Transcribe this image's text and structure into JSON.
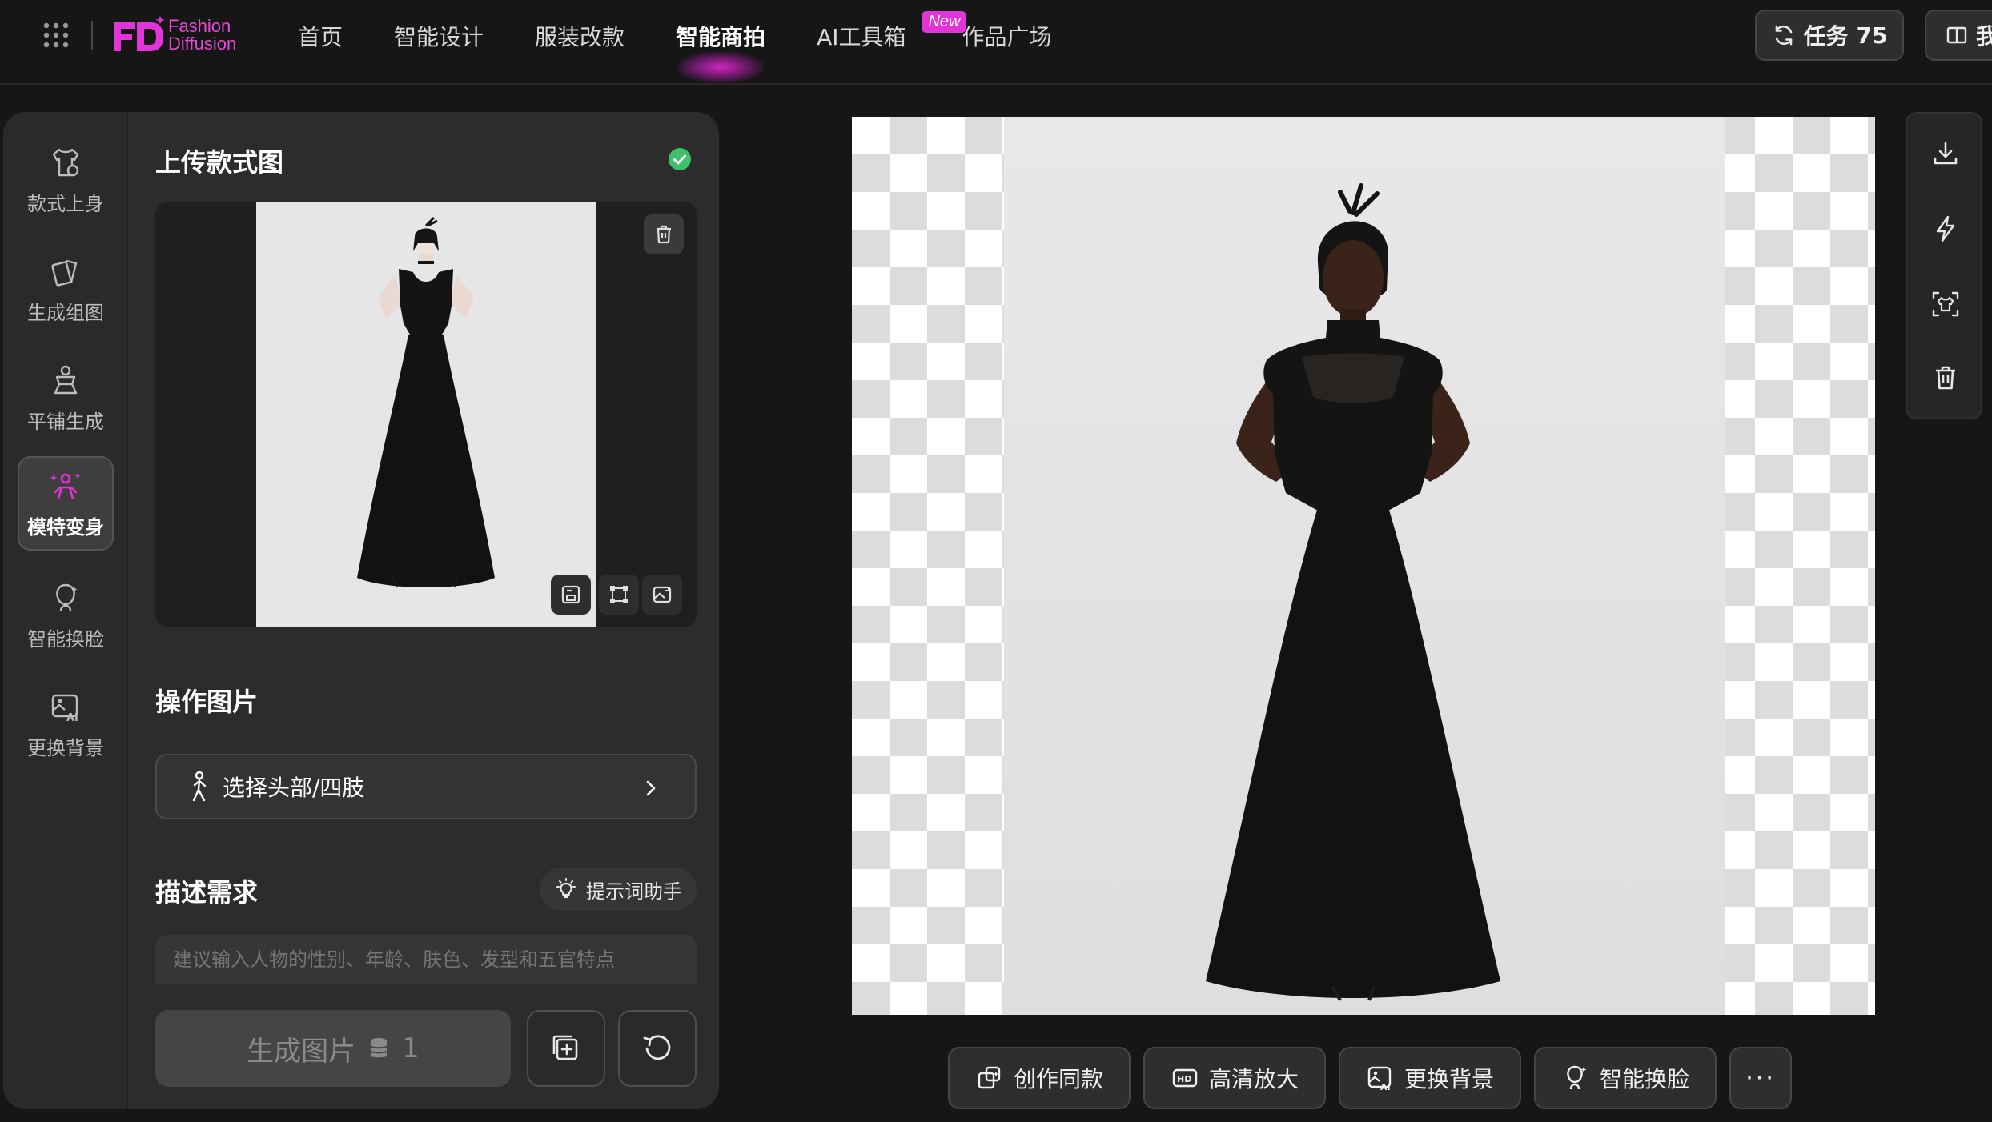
{
  "app": {
    "logo_line1": "Fashion",
    "logo_line2": "Diffusion",
    "brand_color": "#e234d8"
  },
  "nav": {
    "items": [
      {
        "label": "首页"
      },
      {
        "label": "智能设计"
      },
      {
        "label": "服装改款"
      },
      {
        "label": "智能商拍",
        "active": true
      },
      {
        "label": "AI工具箱",
        "badge": "New"
      },
      {
        "label": "作品广场"
      }
    ]
  },
  "header": {
    "tasks_label": "任务",
    "tasks_count": "75",
    "book_label": "我"
  },
  "tools": [
    {
      "label": "款式上身",
      "icon": "shirt-icon"
    },
    {
      "label": "生成组图",
      "icon": "cards-icon"
    },
    {
      "label": "平铺生成",
      "icon": "flat-garment-icon"
    },
    {
      "label": "模特变身",
      "icon": "model-sparkle-icon",
      "active": true
    },
    {
      "label": "智能换脸",
      "icon": "face-swap-icon"
    },
    {
      "label": "更换背景",
      "icon": "ai-background-icon"
    }
  ],
  "upload": {
    "title": "上传款式图",
    "status": "uploaded"
  },
  "operate": {
    "title": "操作图片",
    "select_label": "选择头部/四肢"
  },
  "describe": {
    "title": "描述需求",
    "helper_label": "提示词助手",
    "placeholder": "建议输入人物的性别、年龄、肤色、发型和五官特点"
  },
  "generate": {
    "label": "生成图片",
    "cost": "1"
  },
  "actions": [
    {
      "label": "创作同款",
      "icon": "copy-style-icon"
    },
    {
      "label": "高清放大",
      "icon": "hd-icon"
    },
    {
      "label": "更换背景",
      "icon": "ai-background-icon"
    },
    {
      "label": "智能换脸",
      "icon": "face-swap-icon"
    }
  ],
  "more_label": "···"
}
